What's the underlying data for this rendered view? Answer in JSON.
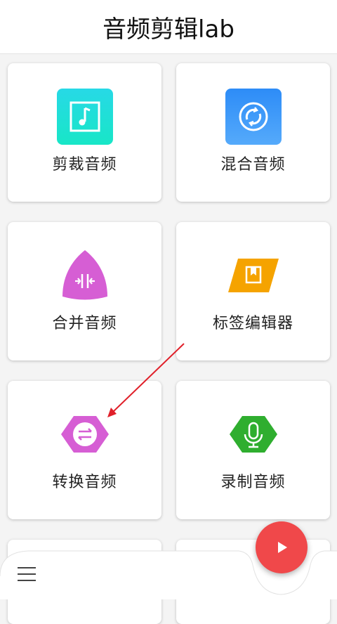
{
  "app": {
    "title": "音频剪辑lab"
  },
  "cards": [
    {
      "label": "剪裁音频",
      "icon": "music-note-file-icon",
      "color": "#1ee0dc"
    },
    {
      "label": "混合音频",
      "icon": "mix-circle-icon",
      "color": "#3f9bff"
    },
    {
      "label": "合并音频",
      "icon": "merge-arrows-icon",
      "color": "#d65ed4"
    },
    {
      "label": "标签编辑器",
      "icon": "bookmark-tag-icon",
      "color": "#f5a300"
    },
    {
      "label": "转换音频",
      "icon": "convert-arrows-icon",
      "color": "#d65ed4"
    },
    {
      "label": "录制音频",
      "icon": "microphone-icon",
      "color": "#2fae2f"
    }
  ],
  "bottom": {
    "menu_icon": "hamburger-menu-icon",
    "fab_icon": "play-icon",
    "fab_color": "#f0484a"
  }
}
